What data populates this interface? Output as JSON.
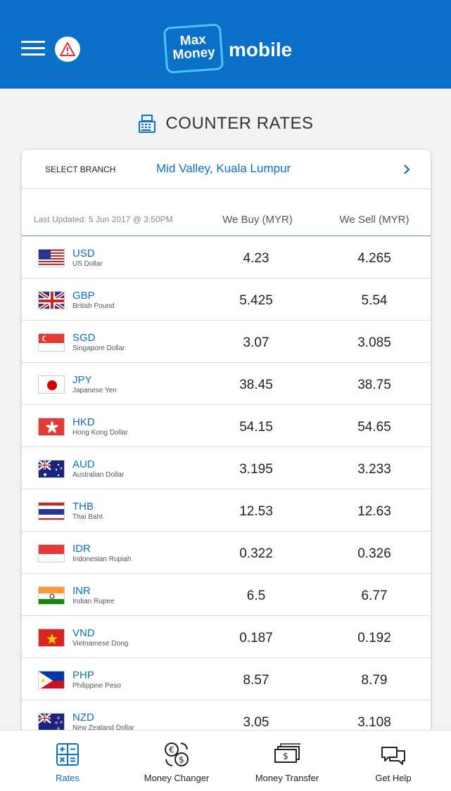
{
  "header": {
    "logo_line1": "Max",
    "logo_line2": "Money",
    "logo_suffix": "mobile",
    "brand_color": "#0a6fc7"
  },
  "page": {
    "title": "COUNTER RATES"
  },
  "branch": {
    "label": "SELECT BRANCH",
    "value": "Mid Valley, Kuala Lumpur"
  },
  "table": {
    "last_updated": "Last Updated: 5 Jun 2017 @ 3:50PM",
    "col_buy": "We Buy (MYR)",
    "col_sell": "We Sell (MYR)",
    "rows": [
      {
        "code": "USD",
        "name": "US Dollar",
        "buy": "4.23",
        "sell": "4.265",
        "flag": "us-flag"
      },
      {
        "code": "GBP",
        "name": "British Pound",
        "buy": "5.425",
        "sell": "5.54",
        "flag": "uk-flag"
      },
      {
        "code": "SGD",
        "name": "Singapore Dollar",
        "buy": "3.07",
        "sell": "3.085",
        "flag": "sg-flag"
      },
      {
        "code": "JPY",
        "name": "Japanese Yen",
        "buy": "38.45",
        "sell": "38.75",
        "flag": "jp-flag"
      },
      {
        "code": "HKD",
        "name": "Hong Kong Dollar",
        "buy": "54.15",
        "sell": "54.65",
        "flag": "hk-flag"
      },
      {
        "code": "AUD",
        "name": "Australian Dollar",
        "buy": "3.195",
        "sell": "3.233",
        "flag": "au-flag"
      },
      {
        "code": "THB",
        "name": "Thai Baht",
        "buy": "12.53",
        "sell": "12.63",
        "flag": "th-flag"
      },
      {
        "code": "IDR",
        "name": "Indonesian Rupiah",
        "buy": "0.322",
        "sell": "0.326",
        "flag": "id-flag"
      },
      {
        "code": "INR",
        "name": "Indian Rupee",
        "buy": "6.5",
        "sell": "6.77",
        "flag": "in-flag"
      },
      {
        "code": "VND",
        "name": "Vietnamese Dong",
        "buy": "0.187",
        "sell": "0.192",
        "flag": "vn-flag"
      },
      {
        "code": "PHP",
        "name": "Philippine Peso",
        "buy": "8.57",
        "sell": "8.79",
        "flag": "ph-flag"
      },
      {
        "code": "NZD",
        "name": "New Zealand Dollar",
        "buy": "3.05",
        "sell": "3.108",
        "flag": "nz-flag"
      }
    ]
  },
  "nav": {
    "rates": "Rates",
    "money_changer": "Money Changer",
    "money_transfer": "Money Transfer",
    "get_help": "Get Help"
  }
}
